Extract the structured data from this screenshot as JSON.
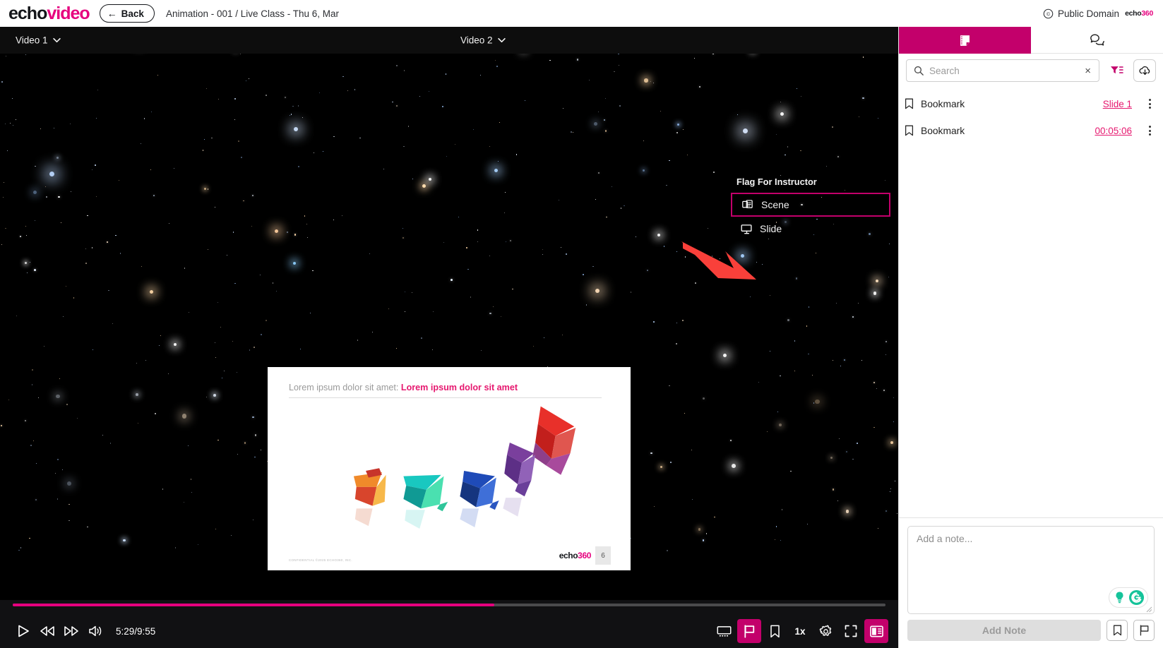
{
  "header": {
    "logo_echo": "echo",
    "logo_video": "video",
    "back_label": "Back",
    "back_arrow": "←",
    "title": "Animation - 001 / Live Class - Thu 6, Mar",
    "license": "Public Domain",
    "license_icon": "copyright-icon",
    "brand_a": "echo",
    "brand_b": "360"
  },
  "player": {
    "video1_label": "Video 1",
    "video2_label": "Video 2",
    "current_time": "5:29",
    "duration": "9:55",
    "time_display": "5:29/9:55",
    "progress_percent": 55.2,
    "speed_label": "1x",
    "controls": {
      "play": "play-icon",
      "rewind": "rewind-icon",
      "forward": "fast-forward-icon",
      "volume": "volume-icon",
      "filmstrip": "filmstrip-icon",
      "flag": "flag-icon",
      "bookmark": "bookmark-icon",
      "settings": "gear-icon",
      "fullscreen": "fullscreen-icon",
      "sidebar_toggle": "sidebar-toggle-icon"
    }
  },
  "slide": {
    "title_plain": "Lorem ipsum dolor sit amet: ",
    "title_accent": "Lorem ipsum dolor sit amet",
    "footer_confidential": "CONFIDENTIAL ©2025 ECHO360, INC.",
    "brand_a": "echo",
    "brand_b": "360",
    "number": "6"
  },
  "flag_menu": {
    "title": "Flag For Instructor",
    "items": [
      {
        "label": "Scene",
        "icon": "scene-icon",
        "highlighted": true
      },
      {
        "label": "Slide",
        "icon": "slide-icon",
        "highlighted": false
      }
    ]
  },
  "sidebar": {
    "tabs": [
      {
        "name": "notes-tab",
        "icon": "note-page-icon",
        "selected": true
      },
      {
        "name": "discussions-tab",
        "icon": "chat-bubbles-icon",
        "selected": false
      }
    ],
    "search": {
      "placeholder": "Search",
      "value": "",
      "icon": "search-icon",
      "clear": "×"
    },
    "filter_icon": "filter-icon",
    "download_icon": "cloud-download-icon",
    "bookmarks": [
      {
        "label": "Bookmark",
        "link": "Slide 1",
        "icon": "bookmark-icon"
      },
      {
        "label": "Bookmark",
        "link": "00:05:06",
        "icon": "bookmark-icon"
      }
    ],
    "note": {
      "placeholder": "Add a note...",
      "value": "",
      "add_label": "Add Note",
      "bookmark_icon": "bookmark-icon",
      "flag_icon": "flag-icon",
      "grammarly_icon": "grammarly-icon",
      "lightbulb_icon": "lightbulb-icon"
    }
  },
  "colors": {
    "accent_pink": "#e6007e",
    "accent_dark_pink": "#c3006b",
    "link_pink": "#e6186f",
    "annotation_red": "#f9403a",
    "grammarly_green": "#15c39a"
  },
  "annotation": {
    "type": "red-arrow",
    "points_to": "flag-control-button"
  }
}
